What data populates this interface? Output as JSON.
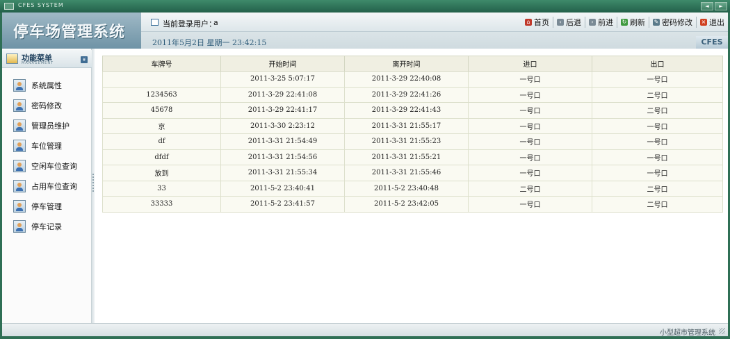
{
  "window": {
    "title": "CFES SYSTEM",
    "buttons": [
      "◄",
      "►"
    ]
  },
  "header": {
    "logo": "停车场管理系统",
    "user_label": "当前登录用户：",
    "user_name": "a",
    "date": "2011年5月2日  星期一  23:42:15",
    "badge": "CFES",
    "toolbar": [
      {
        "label": "首页",
        "icon": "home-icon",
        "glyph": "⌂",
        "color": "#c0392b"
      },
      {
        "label": "后退",
        "icon": "back-icon",
        "glyph": "‹",
        "color": "#7a8a95"
      },
      {
        "label": "前进",
        "icon": "forward-icon",
        "glyph": "›",
        "color": "#7a8a95"
      },
      {
        "label": "刷新",
        "icon": "refresh-icon",
        "glyph": "↻",
        "color": "#3f9a3f"
      },
      {
        "label": "密码修改",
        "icon": "edit-icon",
        "glyph": "✎",
        "color": "#5a7a8a"
      },
      {
        "label": "退出",
        "icon": "exit-icon",
        "glyph": "×",
        "color": "#d04020"
      }
    ]
  },
  "sidebar": {
    "title": "功能菜单",
    "subtitle": "MANAGEMENT",
    "toggle": "¥",
    "items": [
      {
        "label": "系统属性"
      },
      {
        "label": "密码修改"
      },
      {
        "label": "管理员维护"
      },
      {
        "label": "车位管理"
      },
      {
        "label": "空闲车位查询"
      },
      {
        "label": "占用车位查询"
      },
      {
        "label": "停车管理"
      },
      {
        "label": "停车记录"
      }
    ]
  },
  "table": {
    "columns": [
      "车牌号",
      "开始时间",
      "离开时间",
      "进口",
      "出口"
    ],
    "rows": [
      [
        "",
        "2011-3-25 5:07:17",
        "2011-3-29 22:40:08",
        "一号口",
        "一号口"
      ],
      [
        "1234563",
        "2011-3-29 22:41:08",
        "2011-3-29 22:41:26",
        "一号口",
        "二号口"
      ],
      [
        "45678",
        "2011-3-29 22:41:17",
        "2011-3-29 22:41:43",
        "一号口",
        "二号口"
      ],
      [
        "京",
        "2011-3-30 2:23:12",
        "2011-3-31 21:55:17",
        "一号口",
        "一号口"
      ],
      [
        "df",
        "2011-3-31 21:54:49",
        "2011-3-31 21:55:23",
        "一号口",
        "一号口"
      ],
      [
        "dfdf",
        "2011-3-31 21:54:56",
        "2011-3-31 21:55:21",
        "一号口",
        "一号口"
      ],
      [
        "放到",
        "2011-3-31 21:55:34",
        "2011-3-31 21:55:46",
        "一号口",
        "一号口"
      ],
      [
        "33",
        "2011-5-2 23:40:41",
        "2011-5-2 23:40:48",
        "二号口",
        "二号口"
      ],
      [
        "33333",
        "2011-5-2 23:41:57",
        "2011-5-2 23:42:05",
        "一号口",
        "二号口"
      ]
    ]
  },
  "status": {
    "text": "小型超市管理系统"
  }
}
